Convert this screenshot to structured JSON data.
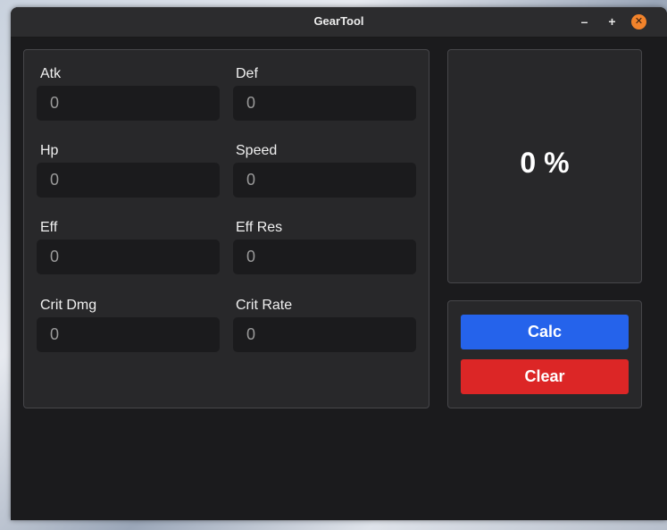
{
  "window": {
    "title": "GearTool"
  },
  "fields": [
    {
      "label": "Atk",
      "value": "",
      "placeholder": "0"
    },
    {
      "label": "Def",
      "value": "",
      "placeholder": "0"
    },
    {
      "label": "Hp",
      "value": "",
      "placeholder": "0"
    },
    {
      "label": "Speed",
      "value": "",
      "placeholder": "0"
    },
    {
      "label": "Eff",
      "value": "",
      "placeholder": "0"
    },
    {
      "label": "Eff Res",
      "value": "",
      "placeholder": "0"
    },
    {
      "label": "Crit Dmg",
      "value": "",
      "placeholder": "0"
    },
    {
      "label": "Crit Rate",
      "value": "",
      "placeholder": "0"
    }
  ],
  "result": {
    "text": "0 %"
  },
  "actions": {
    "calc_label": "Calc",
    "clear_label": "Clear"
  },
  "colors": {
    "calc": "#2563eb",
    "clear": "#dc2626",
    "close": "#f2832b"
  },
  "icons": {
    "minimize": "minimize-icon",
    "maximize": "maximize-icon",
    "close": "close-icon"
  }
}
